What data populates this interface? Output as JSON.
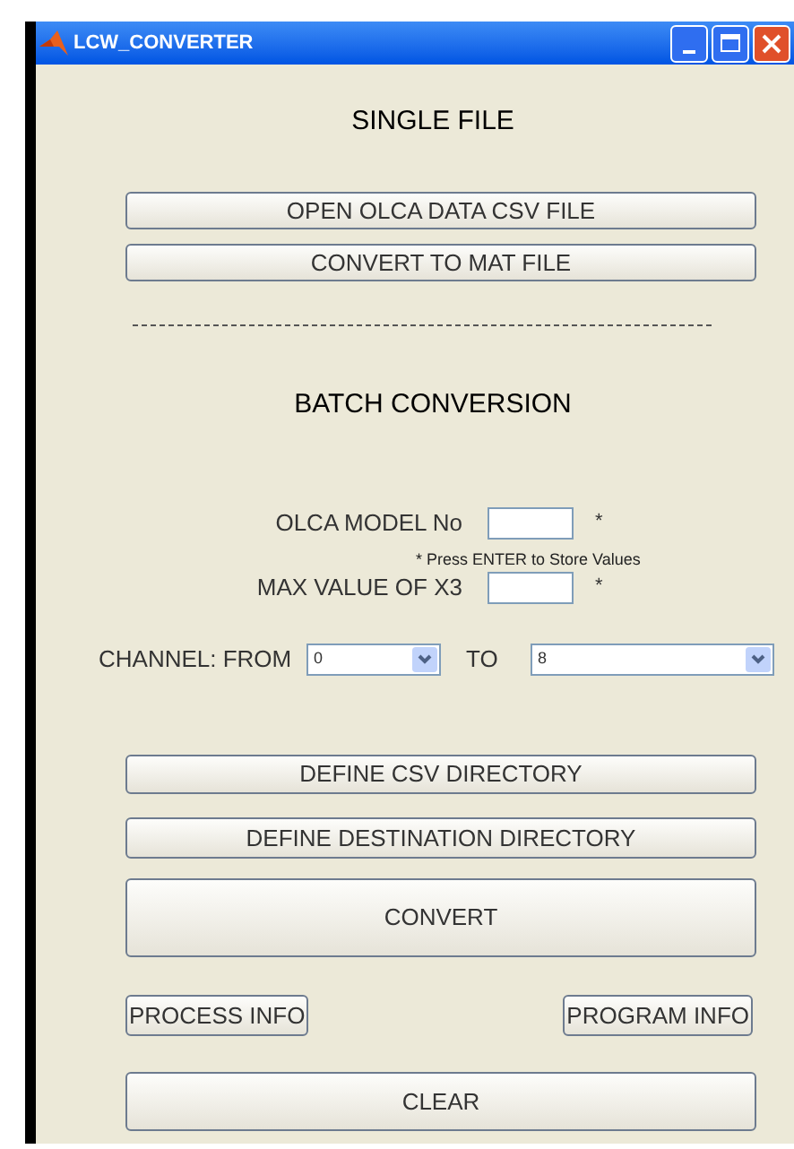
{
  "window": {
    "title": "LCW_CONVERTER"
  },
  "single_file": {
    "heading": "SINGLE FILE",
    "buttons": [
      "OPEN OLCA DATA CSV FILE",
      "CONVERT TO MAT FILE"
    ]
  },
  "batch": {
    "heading": "BATCH CONVERSION",
    "fields": [
      {
        "label": "OLCA MODEL No",
        "mark": "*"
      },
      {
        "label": "MAX VALUE OF X3",
        "mark": "*"
      }
    ],
    "note": "* Press ENTER to Store Values",
    "channel": {
      "label": "CHANNEL: FROM",
      "from": "0",
      "to_label": "TO",
      "to": "8"
    },
    "buttons": [
      "DEFINE CSV DIRECTORY",
      "DEFINE DESTINATION DIRECTORY",
      "CONVERT"
    ],
    "info_buttons": [
      "PROCESS INFO",
      "PROGRAM INFO"
    ],
    "clear_button": "CLEAR"
  }
}
